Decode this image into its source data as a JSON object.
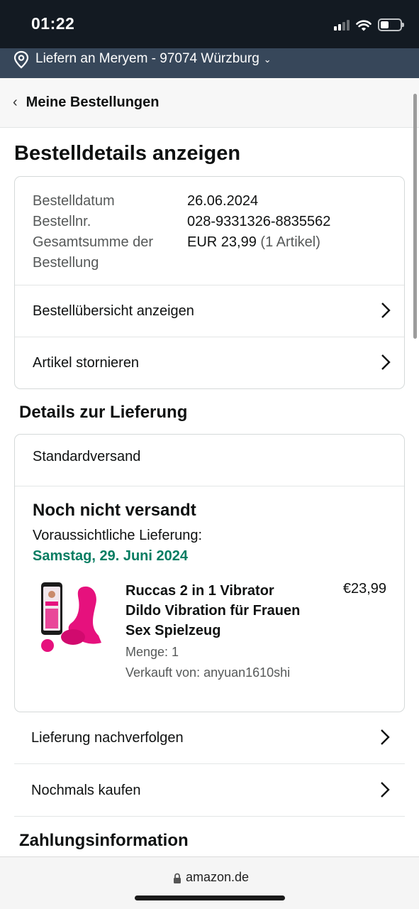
{
  "status_bar": {
    "time": "01:22"
  },
  "location_bar": {
    "text": "Liefern an Meryem - 97074 Würzburg"
  },
  "breadcrumb": {
    "back_label": "Meine Bestellungen"
  },
  "page": {
    "title": "Bestelldetails anzeigen"
  },
  "order_summary": {
    "rows": [
      {
        "key": "Bestelldatum",
        "value": "26.06.2024"
      },
      {
        "key": "Bestellnr.",
        "value": "028-9331326-8835562"
      }
    ],
    "total_key_line1": "Gesamtsumme der",
    "total_key_line2": "Bestellung",
    "total_value": "EUR 23,99",
    "total_items": "(1 Artikel)",
    "links": [
      "Bestellübersicht anzeigen",
      "Artikel stornieren"
    ]
  },
  "delivery": {
    "section_title": "Details zur Lieferung",
    "method": "Standardversand",
    "status": "Noch nicht versandt",
    "eta_label": "Voraussichtliche Lieferung:",
    "eta_date": "Samstag, 29. Juni 2024",
    "eta_color": "#067d62",
    "item": {
      "title": "Ruccas 2 in 1 Vibrator Dildo Vibration für Frauen Sex Spielzeug",
      "price": "€23,99",
      "quantity": "Menge: 1",
      "seller": "Verkauft von: anyuan1610shi"
    }
  },
  "actions": [
    "Lieferung nachverfolgen",
    "Nochmals kaufen"
  ],
  "payment": {
    "section_title": "Zahlungsinformation"
  },
  "browser": {
    "url": "amazon.de"
  },
  "colors": {
    "header_dark": "#131a22",
    "location_bar": "#37475a",
    "accent_pink": "#e6117d"
  }
}
